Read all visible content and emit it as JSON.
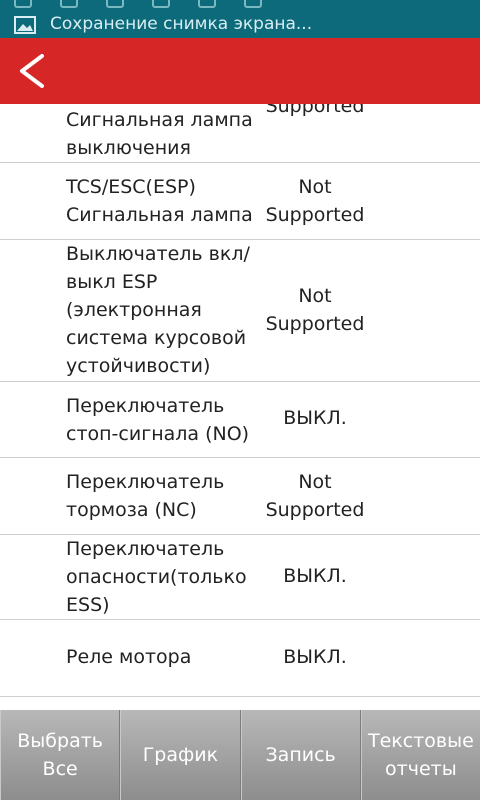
{
  "status_bar": {
    "notification": "Сохранение снимка экрана..."
  },
  "colors": {
    "appbar": "#d72626",
    "statusbar": "#0d6a7a",
    "bottombar": "#a3a3a3"
  },
  "header": {
    "back_icon": "chevron-left-icon"
  },
  "rows": [
    {
      "name": "Сигнальная лампа выключения",
      "value": "Not Supported"
    },
    {
      "name": "TCS/ESC(ESP) Сигнальная лампа",
      "value": "Not Supported"
    },
    {
      "name": "Выключатель вкл/ выкл ESP (электронная система курсовой устойчивости)",
      "value": "Not Supported"
    },
    {
      "name": "Переключатель стоп-сигнала (NO)",
      "value": "ВЫКЛ."
    },
    {
      "name": "Переключатель тормоза (NC)",
      "value": "Not Supported"
    },
    {
      "name": "Переключатель опасности(только ESS)",
      "value": "ВЫКЛ."
    },
    {
      "name": "Реле мотора",
      "value": "ВЫКЛ."
    }
  ],
  "bottom_bar": {
    "select_all": "Выбрать Все",
    "graph": "График",
    "record": "Запись",
    "text_reports": "Текстовые отчеты"
  }
}
